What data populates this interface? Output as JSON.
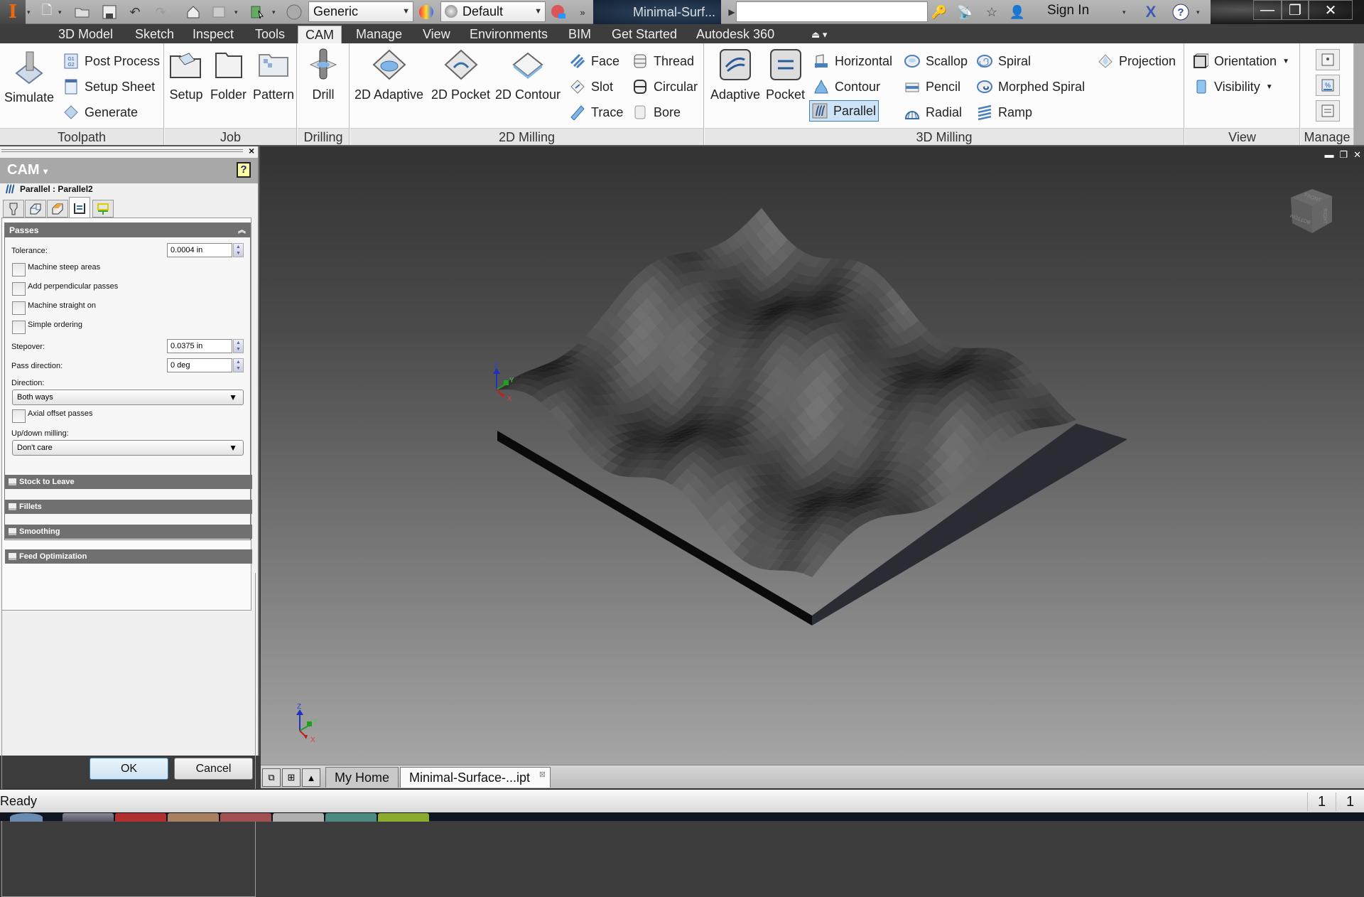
{
  "quick_access": {
    "app_icon": "inventor-app-icon",
    "icons": [
      "new-file-icon",
      "open-folder-icon",
      "save-icon",
      "undo-icon",
      "redo-icon",
      "home-icon",
      "update-icon",
      "select-icon",
      "material-icon"
    ],
    "material_combo": "Generic",
    "appearance_combo": "Default",
    "document_title": "Minimal-Surf...",
    "search_placeholder": "",
    "sign_in": "Sign In",
    "right_icons": [
      "key-icon",
      "satellite-icon",
      "star-icon",
      "user-icon",
      "exchange-icon",
      "help-icon"
    ]
  },
  "window_controls": {
    "minimize": "minimize",
    "restore": "restore",
    "close": "close"
  },
  "ribbon_tabs": [
    {
      "label": "3D Model",
      "active": false
    },
    {
      "label": "Sketch",
      "active": false
    },
    {
      "label": "Inspect",
      "active": false
    },
    {
      "label": "Tools",
      "active": false
    },
    {
      "label": "CAM",
      "active": true
    },
    {
      "label": "Manage",
      "active": false
    },
    {
      "label": "View",
      "active": false
    },
    {
      "label": "Environments",
      "active": false
    },
    {
      "label": "BIM",
      "active": false
    },
    {
      "label": "Get Started",
      "active": false
    },
    {
      "label": "Autodesk 360",
      "active": false
    }
  ],
  "ribbon": {
    "toolpath": {
      "label": "Toolpath",
      "simulate": "Simulate",
      "post_process": "Post Process",
      "setup_sheet": "Setup Sheet",
      "generate": "Generate"
    },
    "job": {
      "label": "Job",
      "setup": "Setup",
      "folder": "Folder",
      "pattern": "Pattern"
    },
    "drilling": {
      "label": "Drilling",
      "drill": "Drill"
    },
    "milling_2d": {
      "label": "2D Milling",
      "adaptive": "2D Adaptive",
      "pocket": "2D Pocket",
      "contour": "2D Contour",
      "face": "Face",
      "slot": "Slot",
      "trace": "Trace",
      "thread": "Thread",
      "circular": "Circular",
      "bore": "Bore"
    },
    "milling_3d": {
      "label": "3D Milling",
      "adaptive": "Adaptive",
      "pocket": "Pocket",
      "horizontal": "Horizontal",
      "contour": "Contour",
      "parallel": "Parallel",
      "scallop": "Scallop",
      "pencil": "Pencil",
      "radial": "Radial",
      "spiral": "Spiral",
      "morphed_spiral": "Morphed Spiral",
      "ramp": "Ramp",
      "projection": "Projection",
      "selected": "Parallel"
    },
    "view": {
      "label": "View",
      "orientation": "Orientation",
      "visibility": "Visibility"
    },
    "manage": {
      "label": "Manage"
    }
  },
  "cam_panel": {
    "title": "CAM",
    "operation": "Parallel : Parallel2",
    "tabs": [
      "tool-tab",
      "geometry-tab",
      "heights-tab",
      "passes-tab",
      "linking-tab"
    ],
    "active_tab": 3,
    "passes": {
      "title": "Passes",
      "tolerance_label": "Tolerance:",
      "tolerance": "0.0004 in",
      "checkboxes": [
        {
          "label": "Machine steep areas",
          "checked": false
        },
        {
          "label": "Add perpendicular passes",
          "checked": false
        },
        {
          "label": "Machine straight on",
          "checked": false
        },
        {
          "label": "Simple ordering",
          "checked": false
        }
      ],
      "stepover_label": "Stepover:",
      "stepover": "0.0375 in",
      "pass_direction_label": "Pass direction:",
      "pass_direction": "0 deg",
      "direction_label": "Direction:",
      "direction": "Both ways",
      "axial_offset_label": "Axial offset passes",
      "axial_offset_checked": false,
      "updown_label": "Up/down milling:",
      "updown": "Don't care"
    },
    "sections": [
      "Stock to Leave",
      "Fillets",
      "Smoothing",
      "Feed Optimization"
    ],
    "ok": "OK",
    "cancel": "Cancel"
  },
  "viewport": {
    "viewcube_faces": {
      "top": "FRONT",
      "left": "BOTTOM",
      "right": "RIGHT"
    },
    "axes": {
      "x": "X",
      "y": "Y",
      "z": "Z"
    },
    "model_color": "#2a2a2a"
  },
  "document_tabs": [
    {
      "label": "My Home",
      "active": false
    },
    {
      "label": "Minimal-Surface-...ipt",
      "active": true
    }
  ],
  "status": {
    "text": "Ready",
    "count1": "1",
    "count2": "1"
  }
}
